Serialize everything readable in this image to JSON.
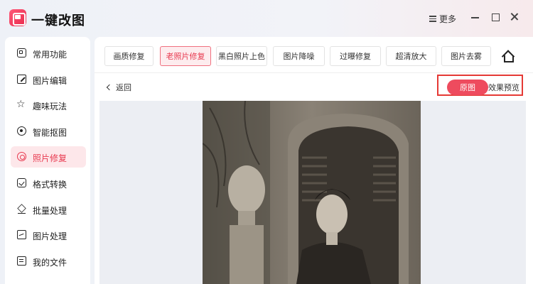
{
  "app": {
    "title": "一键改图"
  },
  "window": {
    "more_label": "更多"
  },
  "sidebar": {
    "items": [
      {
        "label": "常用功能",
        "icon": "grid-icon"
      },
      {
        "label": "图片编辑",
        "icon": "edit-icon"
      },
      {
        "label": "趣味玩法",
        "icon": "star-icon"
      },
      {
        "label": "智能抠图",
        "icon": "target-icon"
      },
      {
        "label": "照片修复",
        "icon": "repair-icon",
        "active": true
      },
      {
        "label": "格式转换",
        "icon": "convert-icon"
      },
      {
        "label": "批量处理",
        "icon": "layers-icon"
      },
      {
        "label": "图片处理",
        "icon": "image-icon"
      },
      {
        "label": "我的文件",
        "icon": "file-icon"
      }
    ]
  },
  "toolbar": {
    "tabs": [
      {
        "label": "画质修复"
      },
      {
        "label": "老照片修复",
        "active": true
      },
      {
        "label": "黑白照片上色"
      },
      {
        "label": "图片降噪"
      },
      {
        "label": "过曝修复"
      },
      {
        "label": "超清放大"
      },
      {
        "label": "图片去雾"
      }
    ]
  },
  "nav": {
    "back_label": "返回"
  },
  "view_toggle": {
    "original_label": "原图",
    "preview_label": "效果预览",
    "selected": "原图"
  },
  "colors": {
    "accent": "#ee4b5e",
    "active_bg": "#fde7ea",
    "highlight_frame": "#e53935"
  }
}
